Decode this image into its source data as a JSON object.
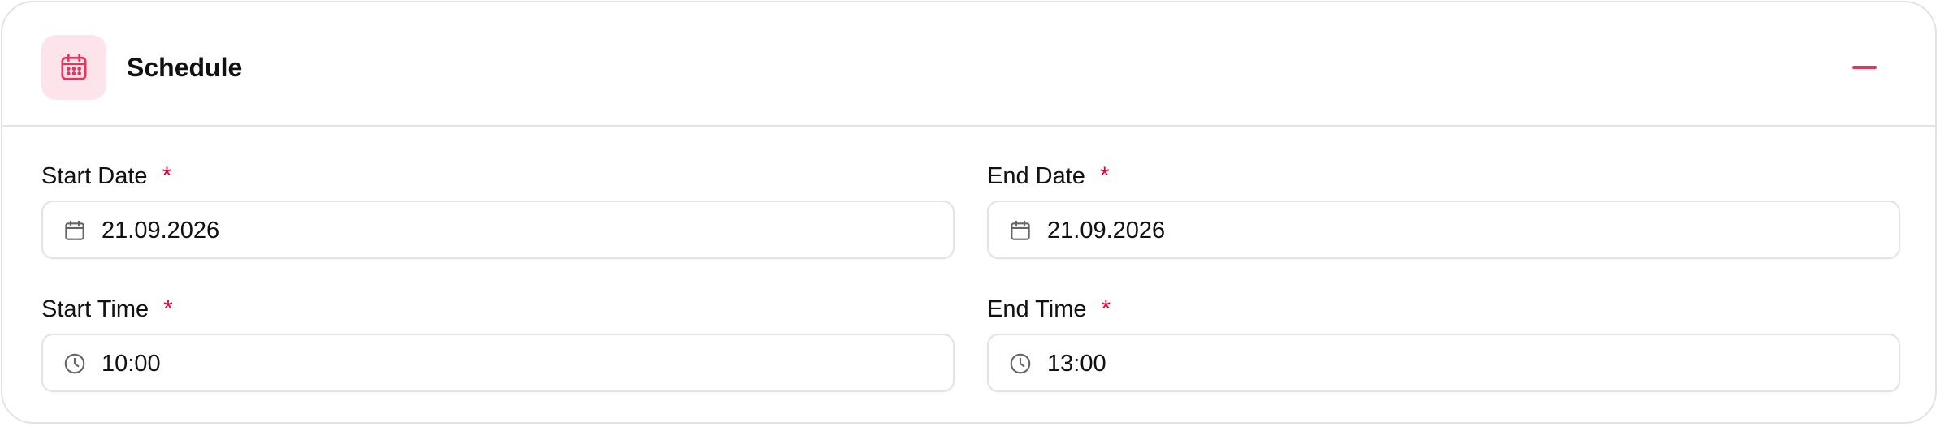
{
  "header": {
    "title": "Schedule",
    "icon": "calendar-icon",
    "collapse_icon": "minus-icon",
    "accent_color": "#e8335a",
    "icon_bg_color": "#fde3ea"
  },
  "fields": {
    "start_date": {
      "label": "Start Date",
      "required_mark": "*",
      "value": "21.09.2026",
      "icon": "calendar-icon"
    },
    "end_date": {
      "label": "End Date",
      "required_mark": "*",
      "value": "21.09.2026",
      "icon": "calendar-icon"
    },
    "start_time": {
      "label": "Start Time",
      "required_mark": "*",
      "value": "10:00",
      "icon": "clock-icon"
    },
    "end_time": {
      "label": "End Time",
      "required_mark": "*",
      "value": "13:00",
      "icon": "clock-icon"
    }
  }
}
